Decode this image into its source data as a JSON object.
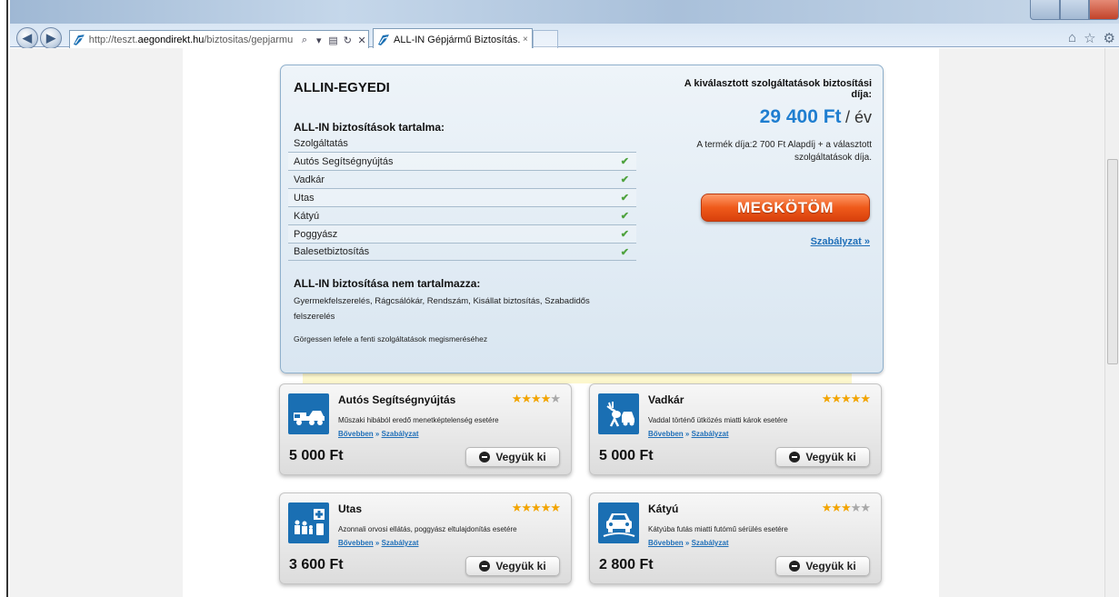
{
  "browser": {
    "url_prefix": "http://teszt.",
    "url_domain": "aegondirekt.hu",
    "url_path": "/biztositas/gepjarmu",
    "tab_title": "ALL-IN Gépjármű Biztosítás...",
    "tab_close": "×"
  },
  "summary": {
    "title": "ALLIN-EGYEDI",
    "included_title": "ALL-IN biztosítások tartalma:",
    "column_header": "Szolgáltatás",
    "services": [
      {
        "label": "Autós Segítségnyújtás"
      },
      {
        "label": "Vadkár"
      },
      {
        "label": "Utas"
      },
      {
        "label": "Kátyú"
      },
      {
        "label": "Poggyász"
      },
      {
        "label": "Balesetbiztosítás"
      }
    ],
    "excluded_title": "ALL-IN biztosítása nem tartalmazza:",
    "excluded_text": "Gyermekfelszerelés, Rágcsálókár, Rendszám, Kisállat biztosítás, Szabadidős felszerelés",
    "scroll_hint": "Görgessen lefele a fenti szolgáltatások megismeréséhez",
    "price_label": "A kiválasztott szolgáltatások biztosítási díja:",
    "price_amount": "29 400 Ft",
    "price_unit": "/ év",
    "price_note": "A termék díja:2 700 Ft Alapdíj + a választott szolgáltatások díja.",
    "cta_label": "MEGKÖTÖM",
    "rules_link": "Szabályzat »"
  },
  "cards": [
    {
      "title": "Autós Segítségnyújtás",
      "rating": 4,
      "rating_max": 5,
      "desc": "Műszaki hibából eredő menetképtelenség esetére",
      "link_more": "Bővebben",
      "link_sep": " » ",
      "link_rules": "Szabályzat",
      "price": "5 000 Ft",
      "button": "Vegyük ki",
      "icon": "tow-truck-icon"
    },
    {
      "title": "Vadkár",
      "rating": 5,
      "rating_max": 5,
      "desc": "Vaddal történő ütközés miatti károk esetére",
      "link_more": "Bővebben",
      "link_sep": " » ",
      "link_rules": "Szabályzat",
      "price": "5 000 Ft",
      "button": "Vegyük ki",
      "icon": "deer-collision-icon"
    },
    {
      "title": "Utas",
      "rating": 5,
      "rating_max": 5,
      "desc": "Azonnali orvosi ellátás, poggyász eltulajdonítás esetére",
      "link_more": "Bővebben",
      "link_sep": " » ",
      "link_rules": "Szabályzat",
      "price": "3 600 Ft",
      "button": "Vegyük ki",
      "icon": "family-medical-icon"
    },
    {
      "title": "Kátyú",
      "rating": 3,
      "rating_max": 5,
      "desc": "Kátyúba futás miatti futómű sérülés esetére",
      "link_more": "Bővebben",
      "link_sep": " » ",
      "link_rules": "Szabályzat",
      "price": "2 800 Ft",
      "button": "Vegyük ki",
      "icon": "pothole-car-icon"
    }
  ],
  "colors": {
    "accent_blue": "#1f7ed0",
    "cta_orange": "#ef5a1a",
    "star": "#f2a400",
    "check": "#4ea23d"
  }
}
